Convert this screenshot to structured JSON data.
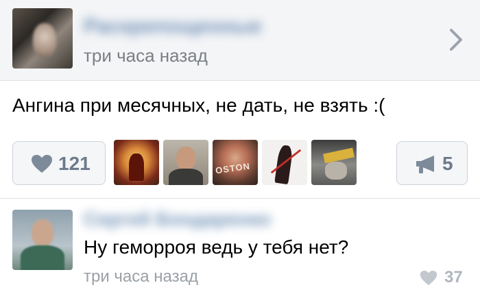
{
  "post": {
    "author_name": "Раскрепощенные",
    "time": "три часа назад",
    "text": "Ангина при месячных, не дать, не взять :(",
    "likes_count": "121",
    "reposts_count": "5",
    "liker_cover_text": "OSTON"
  },
  "comment": {
    "author_name": "Сергей Бондаренко",
    "text": "Ну геморроя ведь у тебя нет?",
    "time": "три часа назад",
    "likes_count": "37"
  },
  "icons": {
    "chevron": "chevron-right-icon",
    "like": "heart-icon",
    "share": "megaphone-icon"
  },
  "colors": {
    "header_bg": "#f4f5f7",
    "link": "#4c75a3",
    "muted": "#7b7f84",
    "button_text": "#6d7a8a"
  }
}
